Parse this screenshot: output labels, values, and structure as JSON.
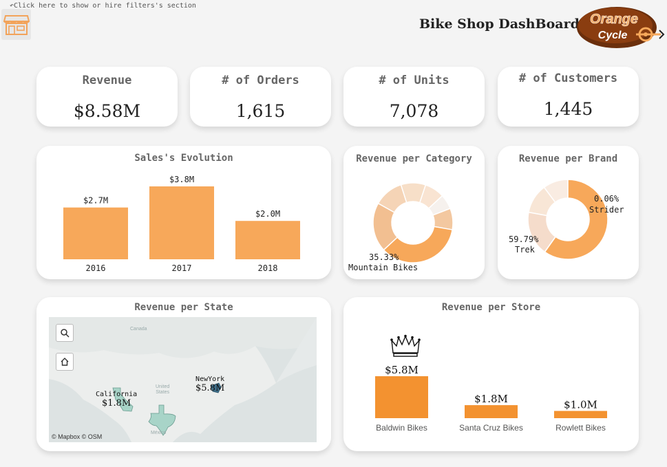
{
  "header": {
    "filter_hint": "↶Click here to show or hire filters's section",
    "title": "Bike Shop DashBoard",
    "logo_text_top": "Orange",
    "logo_text_bottom": "Cycle"
  },
  "kpis": [
    {
      "label": "Revenue",
      "value": "$8.58M"
    },
    {
      "label": "# of Orders",
      "value": "1,615"
    },
    {
      "label": "# of Units",
      "value": "7,078"
    },
    {
      "label": "# of Customers",
      "value": "1,445"
    }
  ],
  "sales_evolution": {
    "title": "Sales's Evolution",
    "bar_color": "#f7a85a",
    "chart_data": {
      "type": "bar",
      "categories": [
        "2016",
        "2017",
        "2018"
      ],
      "values": [
        2.7,
        3.8,
        2.0
      ],
      "labels": [
        "$2.7M",
        "$3.8M",
        "$2.0M"
      ],
      "ylim": [
        0,
        3.8
      ]
    }
  },
  "revenue_per_category": {
    "title": "Revenue per Category",
    "label_pct": "35.33%",
    "label_name": "Mountain Bikes",
    "chart_data": {
      "type": "pie",
      "values": [
        35.33,
        20.0,
        12.0,
        10.0,
        8.0,
        6.0,
        8.67
      ],
      "colors": [
        "#f7a85a",
        "#f2bf91",
        "#f5d4b6",
        "#f7dfc8",
        "#f9e4d2",
        "#f6f1ed",
        "#f3c8a0"
      ]
    }
  },
  "revenue_per_brand": {
    "title": "Revenue per Brand",
    "label1_pct": "59.79%",
    "label1_name": "Trek",
    "label2_pct": "0.06%",
    "label2_name": "Strider",
    "chart_data": {
      "type": "pie",
      "values": [
        59.79,
        0.06,
        18.0,
        12.0,
        10.15
      ],
      "colors": [
        "#f7a85a",
        "#e8c09a",
        "#f5dccb",
        "#f8e6d6",
        "#f9ece2"
      ]
    }
  },
  "revenue_per_state": {
    "title": "Revenue per State",
    "credit": "© Mapbox © OSM",
    "labels": {
      "canada": "Canada",
      "united_states": "United\nStates",
      "mexico": "México"
    },
    "states": [
      {
        "name": "California",
        "value": "$1.8M"
      },
      {
        "name": "NewYork",
        "value": "$5.8M"
      }
    ]
  },
  "revenue_per_store": {
    "title": "Revenue per Store",
    "bar_color": "#f39230",
    "top_icon": "crown-icon",
    "chart_data": {
      "type": "bar",
      "categories": [
        "Baldwin Bikes",
        "Santa Cruz Bikes",
        "Rowlett Bikes"
      ],
      "values": [
        5.8,
        1.8,
        1.0
      ],
      "labels": [
        "$5.8M",
        "$1.8M",
        "$1.0M"
      ],
      "ylim": [
        0,
        5.8
      ]
    }
  }
}
